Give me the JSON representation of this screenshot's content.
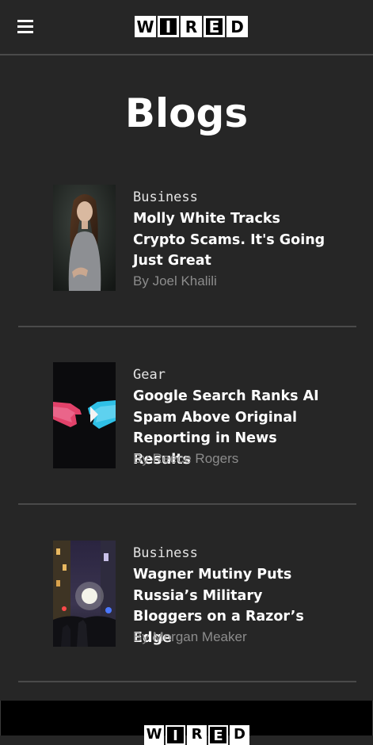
{
  "header": {
    "menu_icon": "hamburger-menu-icon",
    "logo": [
      "W",
      "I",
      "R",
      "E",
      "D"
    ]
  },
  "page": {
    "title": "Blogs"
  },
  "articles": [
    {
      "category": "Business",
      "headline": "Molly White Tracks Crypto Scams. It's Going Just Great",
      "by": "By ",
      "author": "Joel Khalili",
      "image": "portrait of woman against dark background"
    },
    {
      "category": "Gear",
      "headline": "Google Search Ranks AI Spam Above Original Reporting in News Results",
      "by": "By ",
      "author": "Reece Rogers",
      "image": "red and blue hands pointing"
    },
    {
      "category": "Business",
      "headline": "Wagner Mutiny Puts Russia’s Military Bloggers on a Razor’s Edge",
      "by": "By ",
      "author": "Morgan Meaker",
      "image": "night street scene with crowd and lights"
    }
  ],
  "footer": {
    "logo": [
      "W",
      "I",
      "R",
      "E",
      "D"
    ]
  },
  "colors": {
    "background": "#262626",
    "divider": "#4a4a4a",
    "byline": "#8c8c8c",
    "footer": "#000000"
  }
}
